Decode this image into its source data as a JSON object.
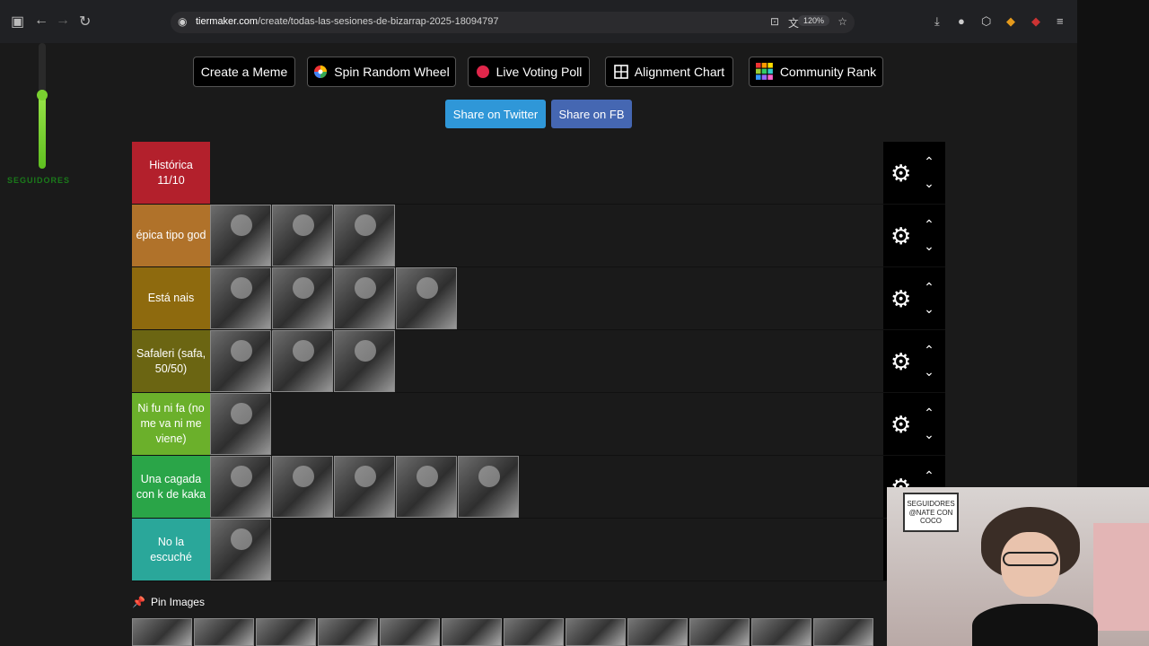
{
  "browser": {
    "url_domain": "tiermaker.com",
    "url_path": "/create/todas-las-sesiones-de-bizarrap-2025-18094797",
    "zoom": "120%"
  },
  "overlay": {
    "meter_label": "SEGUIDORES",
    "meter_level": 0.63
  },
  "toolbar": {
    "create_meme": "Create a Meme",
    "spin_wheel": "Spin Random Wheel",
    "live_poll": "Live Voting Poll",
    "alignment_chart": "Alignment Chart",
    "community_rank": "Community Rank"
  },
  "share": {
    "twitter": "Share on Twitter",
    "facebook": "Share on FB"
  },
  "tiers": [
    {
      "label": "Histórica 11/10",
      "color": "#b3202c",
      "items": 0
    },
    {
      "label": "épica tipo god",
      "color": "#b0722a",
      "items": 3
    },
    {
      "label": "Está nais",
      "color": "#8e6a0e",
      "items": 4
    },
    {
      "label": "Safaleri (safa, 50/50)",
      "color": "#6b6512",
      "items": 3
    },
    {
      "label": "Ni fu ni fa (no me va ni me viene)",
      "color": "#6bb02b",
      "items": 1
    },
    {
      "label": "Una cagada con k de kaka",
      "color": "#2aa548",
      "items": 5
    },
    {
      "label": "No la escuché",
      "color": "#2aa79a",
      "items": 1
    }
  ],
  "pool": {
    "pin_label": "Pin Images",
    "visible_items": 12
  },
  "webcam": {
    "poster_text": "SEGUIDORES @NATE CON COCO"
  },
  "icons": [
    "lock-icon",
    "gear-icon",
    "chevron-up-icon",
    "chevron-down-icon",
    "pin-icon",
    "spin-wheel-icon",
    "live-dot-icon",
    "grid-icon",
    "community-grid-icon"
  ]
}
